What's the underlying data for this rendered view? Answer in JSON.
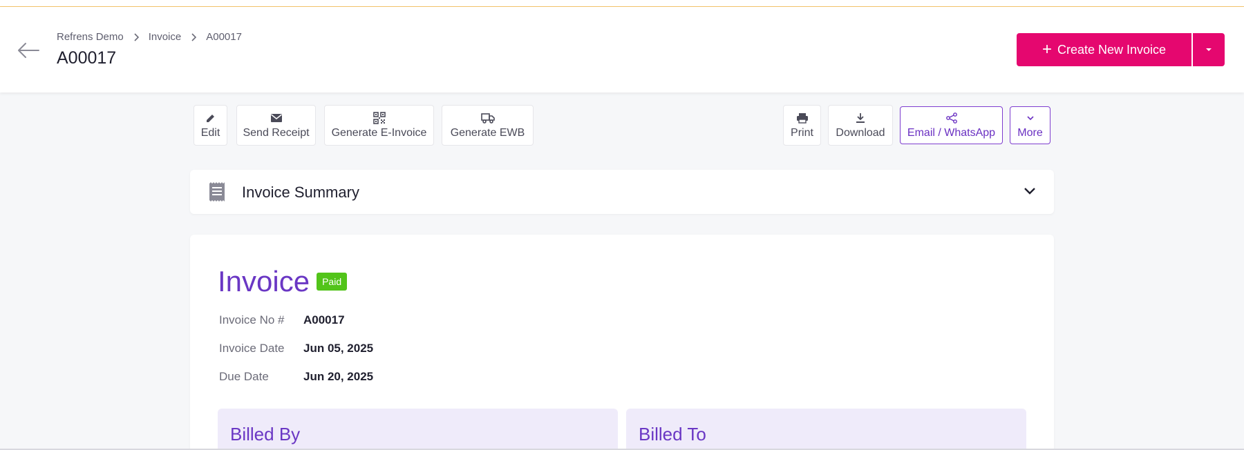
{
  "header": {
    "breadcrumb": [
      "Refrens Demo",
      "Invoice",
      "A00017"
    ],
    "page_title": "A00017",
    "create_button": "Create New Invoice"
  },
  "toolbar": {
    "edit": "Edit",
    "send_receipt": "Send Receipt",
    "generate_einvoice": "Generate E-Invoice",
    "generate_ewb": "Generate EWB",
    "print": "Print",
    "download": "Download",
    "email_whatsapp": "Email / WhatsApp",
    "more": "More"
  },
  "summary": {
    "label": "Invoice Summary"
  },
  "invoice": {
    "title": "Invoice",
    "status": "Paid",
    "fields": [
      {
        "label": "Invoice No #",
        "value": "A00017"
      },
      {
        "label": "Invoice Date",
        "value": "Jun 05, 2025"
      },
      {
        "label": "Due Date",
        "value": "Jun 20, 2025"
      }
    ],
    "billed_by": "Billed By",
    "billed_to": "Billed To"
  },
  "colors": {
    "brand_pink": "#e5076f",
    "accent_purple": "#6a37c4",
    "paid_green": "#52c41a"
  }
}
